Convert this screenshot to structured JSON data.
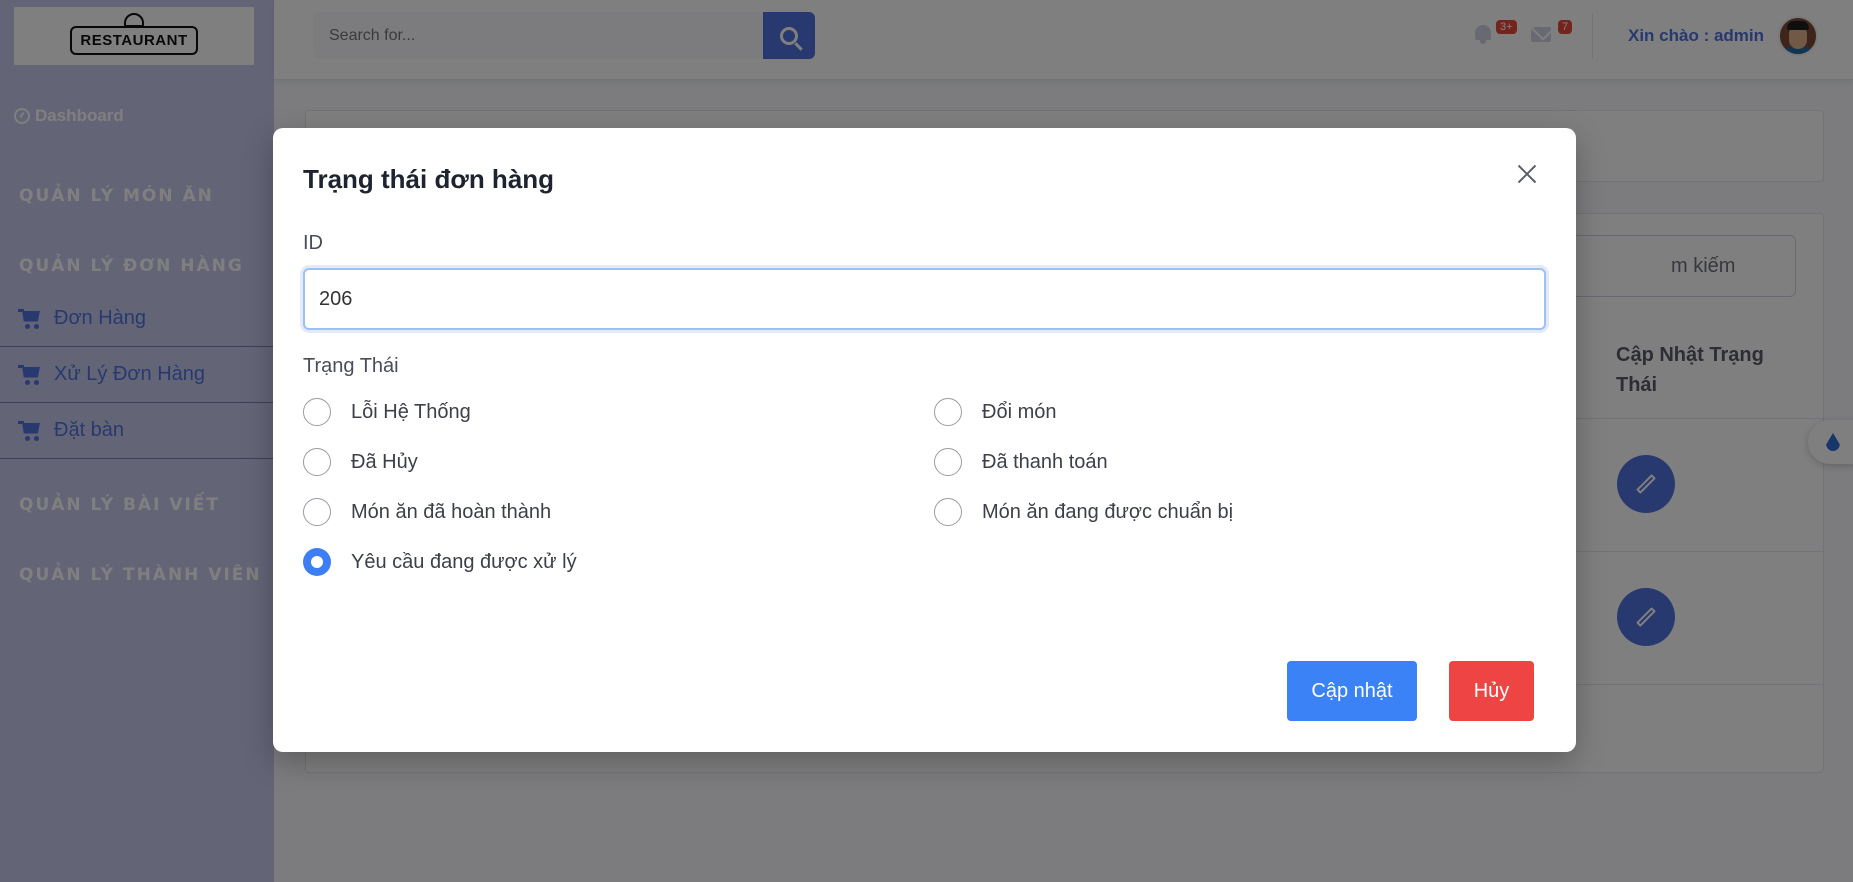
{
  "topbar": {
    "search_placeholder": "Search for...",
    "alerts_badge": "3+",
    "messages_badge": "7",
    "greeting": "Xin chào : admin"
  },
  "sidebar": {
    "logo_text": "RESTAURANT",
    "dashboard": "Dashboard",
    "sections": {
      "dish": "QUẢN LÝ MÓN ĂN",
      "order": "QUẢN LÝ ĐƠN HÀNG",
      "post": "QUẢN LÝ BÀI VIẾT",
      "member": "QUẢN LÝ THÀNH VIÊN"
    },
    "items": [
      {
        "label": "Đơn Hàng"
      },
      {
        "label": "Xử Lý Đơn Hàng"
      },
      {
        "label": "Đặt bàn"
      }
    ]
  },
  "background": {
    "search_text": "m kiếm",
    "column_header": "Cập Nhật Trạng Thái"
  },
  "modal": {
    "title": "Trạng thái đơn hàng",
    "id_label": "ID",
    "id_value": "206",
    "status_label": "Trạng Thái",
    "options": [
      {
        "label": "Lỗi Hệ Thống",
        "checked": false
      },
      {
        "label": "Đổi món",
        "checked": false
      },
      {
        "label": "Đã Hủy",
        "checked": false
      },
      {
        "label": "Đã thanh toán",
        "checked": false
      },
      {
        "label": "Món ăn đã hoàn thành",
        "checked": false
      },
      {
        "label": "Món ăn đang được chuẩn bị",
        "checked": false
      },
      {
        "label": "Yêu cầu đang được xử lý",
        "checked": true
      }
    ],
    "update_button": "Cập nhật",
    "cancel_button": "Hủy"
  },
  "colors": {
    "primary": "#4e73df",
    "update": "#3b82f6",
    "cancel": "#ef4444",
    "sidebar": "#c7caee"
  }
}
